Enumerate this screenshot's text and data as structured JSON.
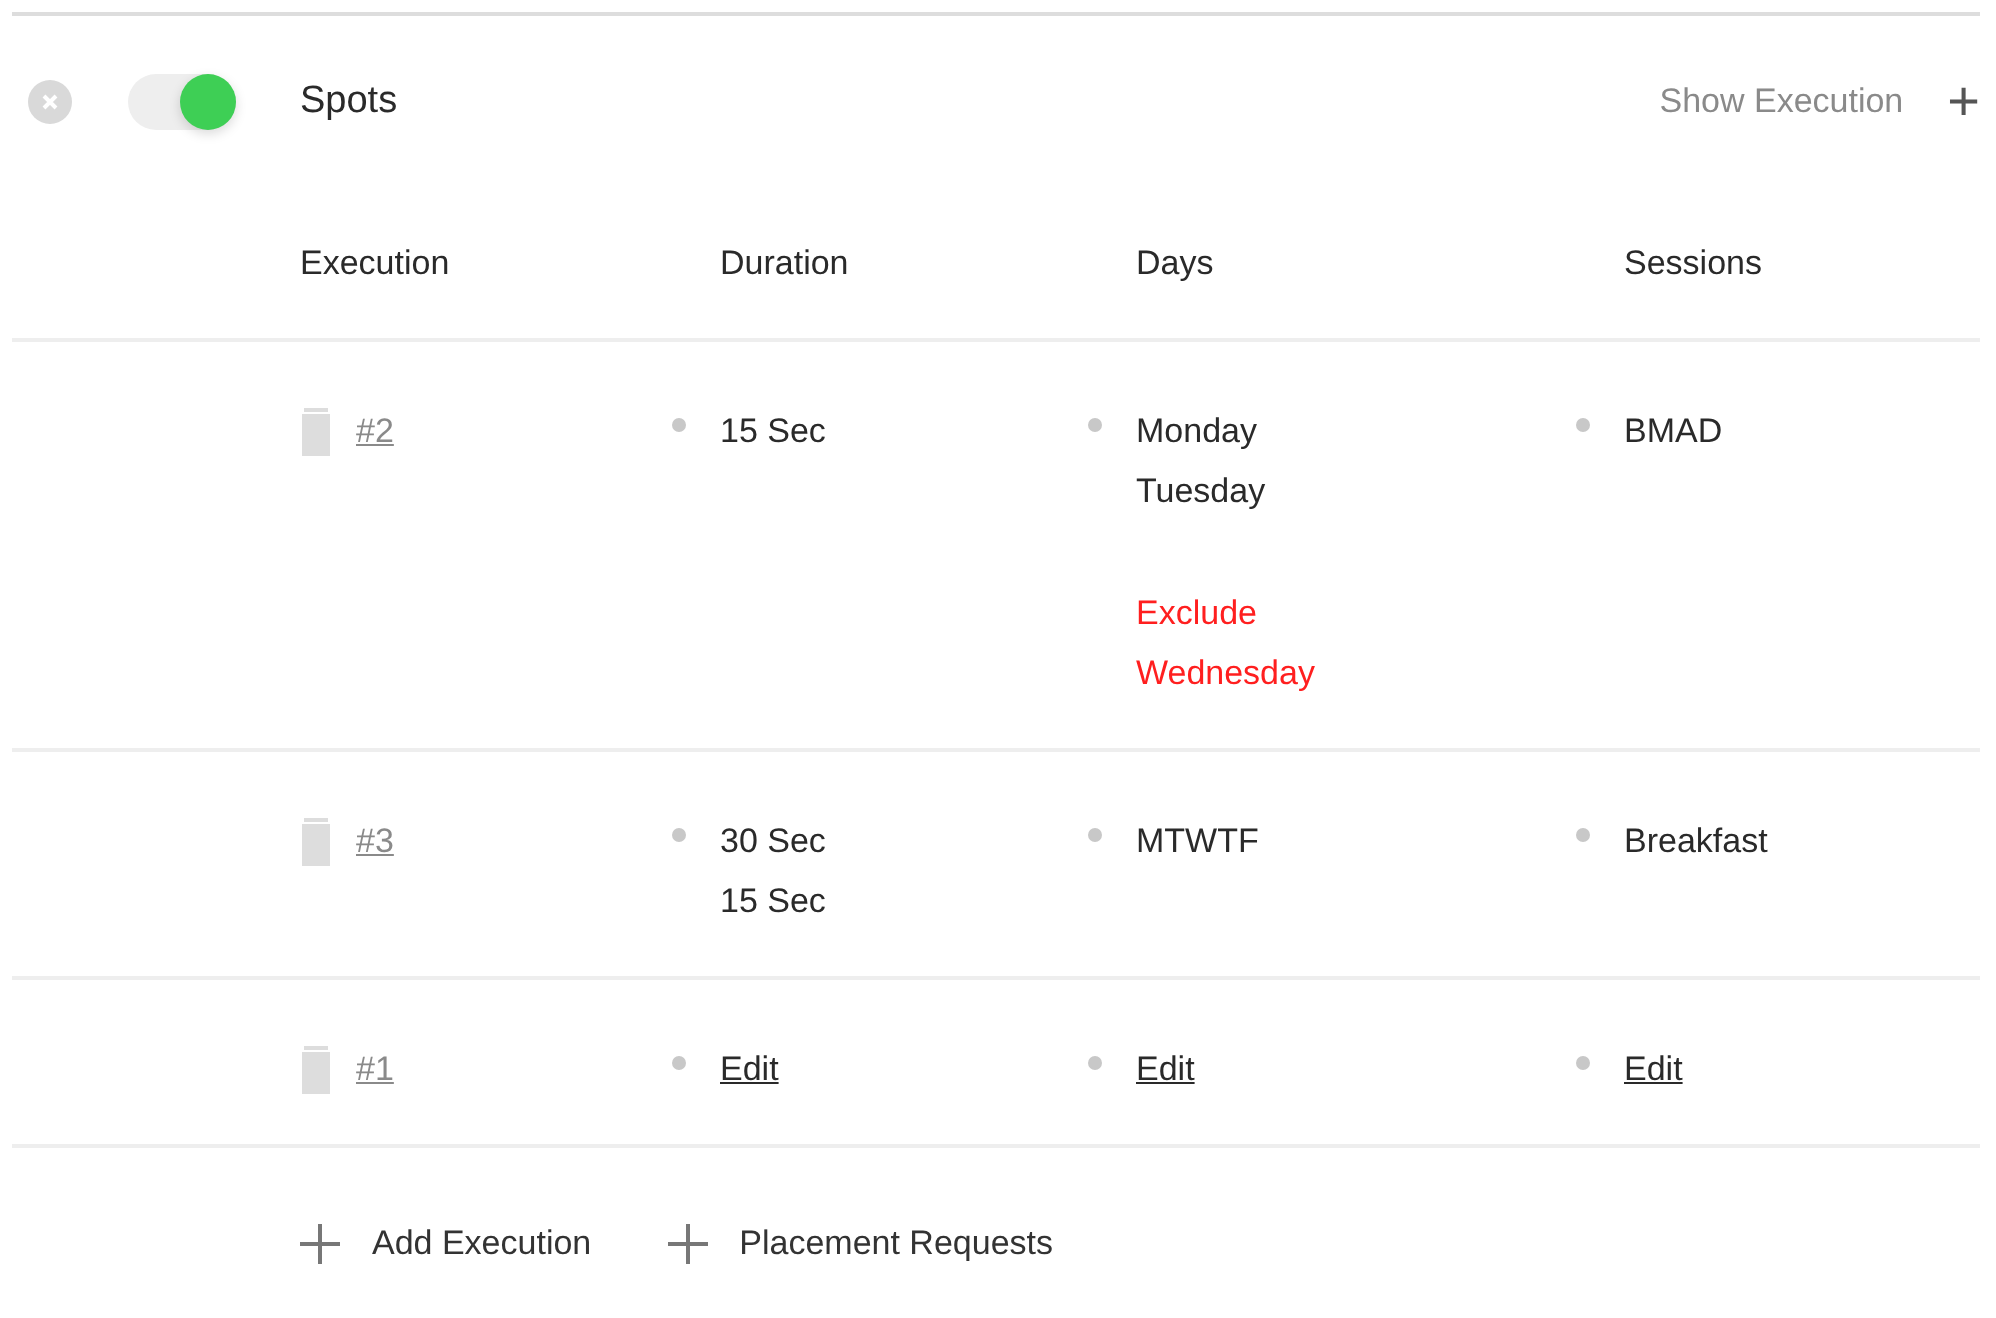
{
  "section": {
    "title": "Spots",
    "enabled": true,
    "action": "Show Execution",
    "add_icon": "+"
  },
  "columns": [
    "Execution",
    "Duration",
    "Days",
    "Sessions"
  ],
  "rows": [
    {
      "id": "#2",
      "duration": [
        {
          "text": "15 Sec",
          "kind": "plain"
        }
      ],
      "days": [
        {
          "text": "Monday",
          "kind": "plain"
        },
        {
          "text": "Tuesday",
          "kind": "plain"
        },
        {
          "text": "Exclude",
          "kind": "exclude"
        },
        {
          "text": "Wednesday",
          "kind": "exclude"
        }
      ],
      "sessions": [
        {
          "text": "BMAD",
          "kind": "plain"
        }
      ]
    },
    {
      "id": "#3",
      "duration": [
        {
          "text": "30 Sec",
          "kind": "plain"
        },
        {
          "text": "15 Sec",
          "kind": "plain"
        }
      ],
      "days": [
        {
          "text": "MTWTF",
          "kind": "plain"
        }
      ],
      "sessions": [
        {
          "text": "Breakfast",
          "kind": "plain"
        }
      ]
    },
    {
      "id": "#1",
      "duration": [
        {
          "text": "Edit",
          "kind": "link"
        }
      ],
      "days": [
        {
          "text": "Edit",
          "kind": "link"
        }
      ],
      "sessions": [
        {
          "text": "Edit",
          "kind": "link"
        }
      ]
    }
  ],
  "footer": [
    {
      "label": "Add Execution"
    },
    {
      "label": "Placement Requests"
    }
  ]
}
